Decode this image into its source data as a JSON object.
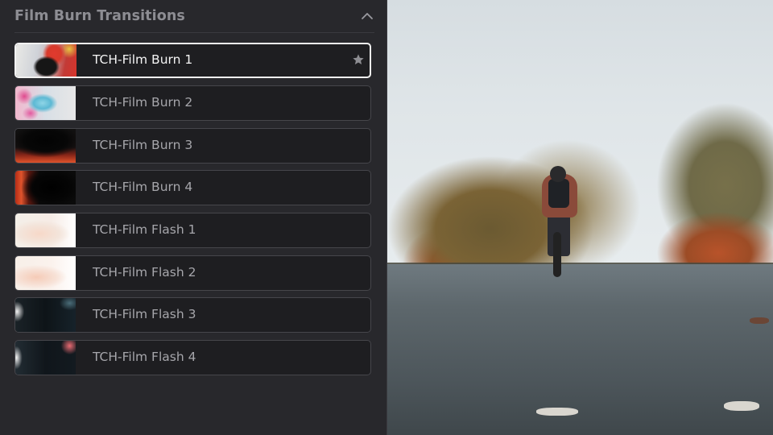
{
  "panel": {
    "title": "Film Burn Transitions",
    "collapse_icon": "chevron-up-icon",
    "favorite_icon": "star-icon",
    "selected_index": 0,
    "items": [
      {
        "label": "TCH-Film Burn 1"
      },
      {
        "label": "TCH-Film Burn 2"
      },
      {
        "label": "TCH-Film Burn 3"
      },
      {
        "label": "TCH-Film Burn 4"
      },
      {
        "label": "TCH-Film Flash 1"
      },
      {
        "label": "TCH-Film Flash 2"
      },
      {
        "label": "TCH-Film Flash 3"
      },
      {
        "label": "TCH-Film Flash 4"
      }
    ]
  },
  "colors": {
    "panel_bg": "#28282c",
    "item_bg": "#1e1e21",
    "item_border": "#46464b",
    "selected_border": "#f2f2f2",
    "title_text": "#8d8d93",
    "label_text": "#a6a6ab",
    "selected_label_text": "#f4f4f4"
  },
  "viewer": {
    "content": "preview-image"
  }
}
